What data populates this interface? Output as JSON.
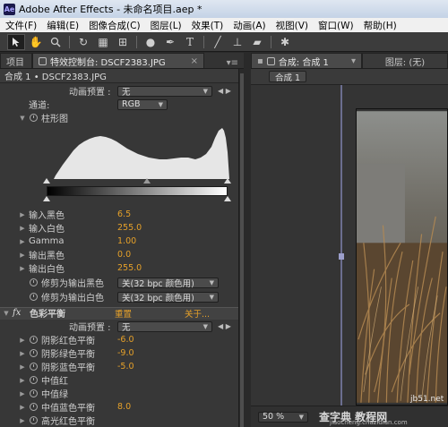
{
  "window": {
    "title": "Adobe After Effects - 未命名项目.aep *",
    "logo": "Ae"
  },
  "menu": [
    "文件(F)",
    "编辑(E)",
    "图像合成(C)",
    "图层(L)",
    "效果(T)",
    "动画(A)",
    "视图(V)",
    "窗口(W)",
    "帮助(H)"
  ],
  "toolbar": {
    "icons": [
      "selection-arrow",
      "hand",
      "zoom",
      "rotate",
      "camera-orbit",
      "pan-behind",
      "ellipse-mask",
      "pen",
      "text",
      "brush",
      "clone-stamp",
      "eraser",
      "puppet-pin"
    ]
  },
  "left_panel": {
    "tabs": {
      "project": "项目",
      "effects": "特效控制台: DSCF2383.JPG",
      "menu": "▾≡"
    },
    "header": "合成 1 • DSCF2383.JPG",
    "levels": {
      "anim_preset_label": "动画预置 :",
      "anim_preset_value": "无",
      "channel_label": "通道:",
      "channel_value": "RGB",
      "histogram_label": "柱形图",
      "input_black_label": "输入黑色",
      "input_black": "6.5",
      "input_white_label": "输入白色",
      "input_white": "255.0",
      "gamma_label": "Gamma",
      "gamma": "1.00",
      "output_black_label": "输出黑色",
      "output_black": "0.0",
      "output_white_label": "输出白色",
      "output_white": "255.0",
      "clip_black_label": "修剪为输出黑色",
      "clip_black_value": "关(32 bpc 颜色用)",
      "clip_white_label": "修剪为输出白色",
      "clip_white_value": "关(32 bpc 颜色用)"
    },
    "color_balance": {
      "fx": "fx",
      "name": "色彩平衡",
      "reset": "重置",
      "about": "关于...",
      "anim_preset_label": "动画预置 :",
      "anim_preset_value": "无",
      "shadow_red_label": "阴影红色平衡",
      "shadow_red": "-6.0",
      "shadow_green_label": "阴影绿色平衡",
      "shadow_green": "-9.0",
      "shadow_blue_label": "阴影蓝色平衡",
      "shadow_blue": "-5.0",
      "mid_red_label": "中值红",
      "mid_green_label": "中值绿",
      "mid_blue_label": "中值蓝色平衡",
      "mid_blue": "8.0",
      "hi_red_label": "高光红色平衡"
    }
  },
  "right_panel": {
    "tab_comp": "合成: 合成 1",
    "tab_layer": "图层: (无)",
    "subtab": "合成 1",
    "zoom": "50 %"
  },
  "watermark": {
    "site": "jb51.net",
    "text1": "查字典 教程网",
    "text2": "jiaocheng.chazidian.com"
  },
  "colors": {
    "value": "#e5a029",
    "panel": "#373737"
  }
}
